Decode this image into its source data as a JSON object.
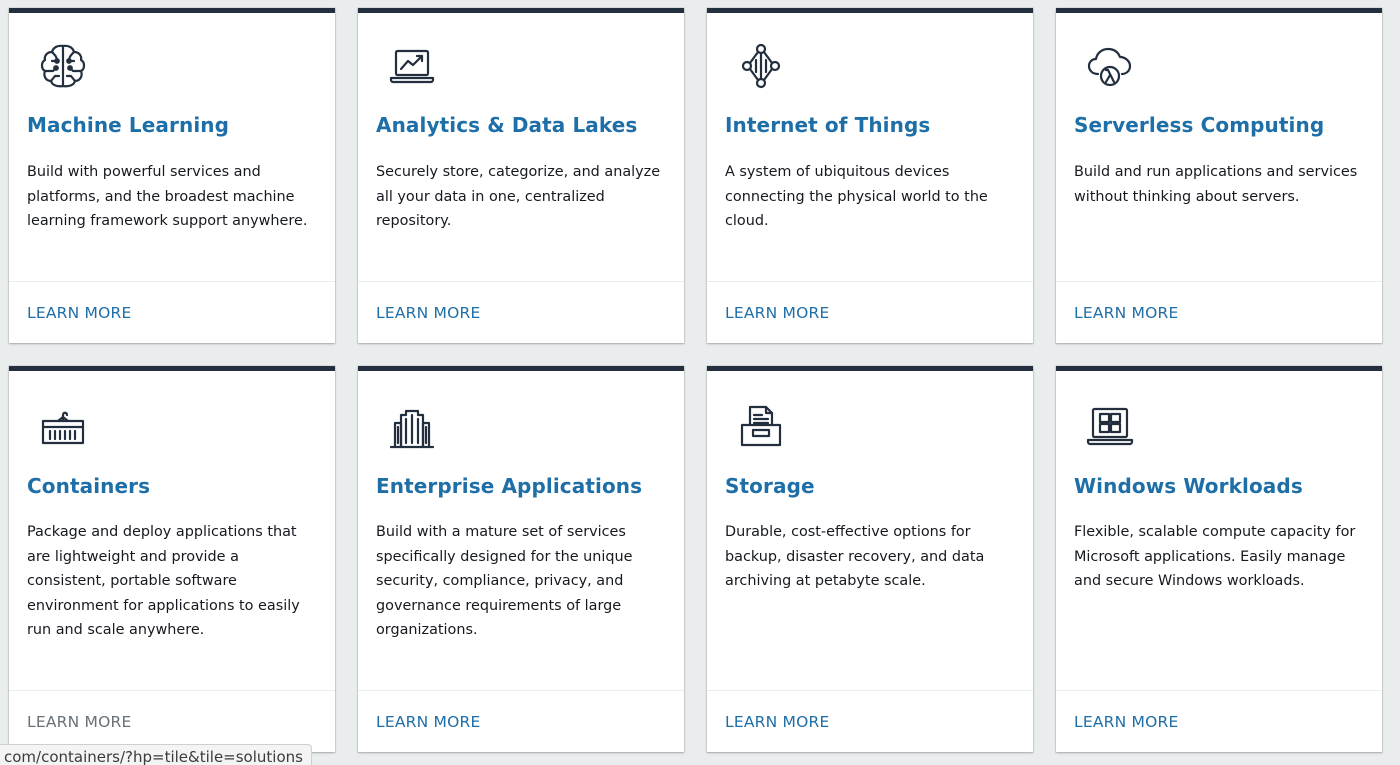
{
  "cards": [
    {
      "icon": "brain-icon",
      "title": "Machine Learning",
      "description": "Build with powerful services and platforms, and the broadest machine learning framework support anywhere.",
      "link": "LEARN MORE"
    },
    {
      "icon": "laptop-chart-icon",
      "title": "Analytics & Data Lakes",
      "description": "Securely store, categorize, and analyze all your data in one, centralized repository.",
      "link": "LEARN MORE"
    },
    {
      "icon": "iot-network-icon",
      "title": "Internet of Things",
      "description": "A system of ubiquitous devices connecting the physical world to the cloud.",
      "link": "LEARN MORE"
    },
    {
      "icon": "cloud-lambda-icon",
      "title": "Serverless Computing",
      "description": "Build and run applications and services without thinking about servers.",
      "link": "LEARN MORE"
    },
    {
      "icon": "container-icon",
      "title": "Containers",
      "description": "Package and deploy applications that are lightweight and provide a consistent, portable software environment for applications to easily run and scale anywhere.",
      "link": "LEARN MORE"
    },
    {
      "icon": "buildings-icon",
      "title": "Enterprise Applications",
      "description": "Build with a mature set of services specifically designed for the unique security, compliance, privacy, and governance requirements of large organizations.",
      "link": "LEARN MORE"
    },
    {
      "icon": "archive-box-icon",
      "title": "Storage",
      "description": "Durable, cost-effective options for backup, disaster recovery, and data archiving at petabyte scale.",
      "link": "LEARN MORE"
    },
    {
      "icon": "windows-laptop-icon",
      "title": "Windows Workloads",
      "description": "Flexible, scalable compute capacity for Microsoft applications. Easily manage and secure Windows workloads.",
      "link": "LEARN MORE"
    }
  ],
  "status_bar": {
    "url": "com/containers/?hp=tile&tile=solutions"
  },
  "colors": {
    "title": "#1e6ea7",
    "link": "#1e6ea7",
    "link_visited": "#687078",
    "card_top_border": "#232f3e",
    "background": "#eaeded"
  }
}
